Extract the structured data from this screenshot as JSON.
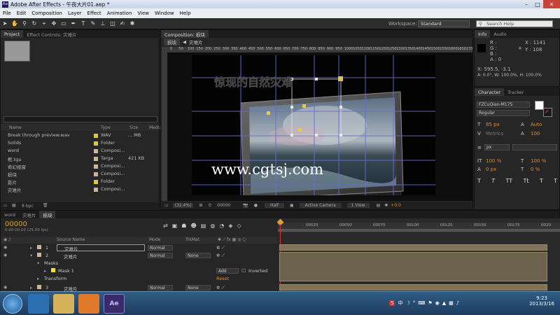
{
  "window": {
    "title": "Adobe After Effects - 午夜大片01.aep *",
    "app_badge": "Ae"
  },
  "menu": [
    "File",
    "Edit",
    "Composition",
    "Layer",
    "Effect",
    "Animation",
    "View",
    "Window",
    "Help"
  ],
  "toolbar": {
    "workspace_label": "Workspace:",
    "workspace_value": "Standard",
    "search_placeholder": "Search Help"
  },
  "project": {
    "tabs": [
      "Project",
      "Effect Controls: 灾难片"
    ],
    "columns": [
      "Name",
      "Type",
      "Size",
      "Media"
    ],
    "items": [
      {
        "name": "Break through preview.wav",
        "type": "WAV",
        "size": "... MB",
        "color": "#d8c64a"
      },
      {
        "name": "Solids",
        "type": "Folder",
        "size": "",
        "color": "#d8c64a"
      },
      {
        "name": "word",
        "type": "Composi...",
        "size": "",
        "color": "#c8b79a"
      },
      {
        "name": "框.tga",
        "type": "Targa",
        "size": "421 KB",
        "color": "#c8b79a"
      },
      {
        "name": "奇幻视窗",
        "type": "Composi...",
        "size": "",
        "color": "#c8b79a"
      },
      {
        "name": "损块",
        "type": "Composi...",
        "size": "",
        "color": "#c8b79a"
      },
      {
        "name": "影片",
        "type": "Folder",
        "size": "",
        "color": "#d8c64a"
      },
      {
        "name": "灾难片",
        "type": "Composi...",
        "size": "",
        "color": "#c8b79a"
      }
    ],
    "bpc": "8 bpc"
  },
  "composition": {
    "tab": "Composition: 损块",
    "breadcrumbs": [
      "损块",
      "灾难片"
    ],
    "ruler_ticks": [
      "0",
      "50",
      "100",
      "150",
      "200",
      "250",
      "300",
      "350",
      "400",
      "450",
      "500",
      "550",
      "600",
      "650",
      "700",
      "750",
      "800",
      "850",
      "900",
      "950",
      "1000",
      "1050",
      "1100",
      "1150",
      "1200",
      "1250",
      "1300",
      "1350",
      "1400",
      "1450",
      "1500",
      "1550",
      "1600",
      "1650",
      "1700"
    ],
    "title_text": "惊现的自然灾难",
    "watermark": "www.cgtsj.com",
    "footer": {
      "zoom": "(32.4%)",
      "timecode": "00000",
      "resolution": "Half",
      "camera": "Active Camera",
      "views": "1 View",
      "exposure": "+0.0"
    }
  },
  "info": {
    "tabs": [
      "Info",
      "Audio"
    ],
    "r": "R :",
    "g": "G :",
    "b": "B :",
    "a": "A : 0",
    "x": "X : 1141",
    "y": "Y : 108",
    "line1": "X: 595.5, -3.1",
    "line2": "A: 0.0°, W: 100.0%, H: 100.0%"
  },
  "character": {
    "tabs": [
      "Character",
      "Tracker"
    ],
    "font": "FZCuQian-M17S",
    "style": "Regular",
    "size": "85 px",
    "leading": "Auto",
    "kerning": "Metrics",
    "tracking": "100",
    "stroke_unit": "px",
    "vscale": "100 %",
    "hscale": "100 %",
    "baseline": "0 px",
    "tsume": "0 %",
    "styles": [
      "T",
      "T",
      "TT",
      "Tt",
      "T",
      "T"
    ]
  },
  "timeline": {
    "tabs": [
      "word",
      "灾难片",
      "损块"
    ],
    "timecode": "00000",
    "timecode_sub": "0:00:00:00 (25.00 fps)",
    "headers": {
      "source": "Source Name",
      "mode": "Mode",
      "trkmat": "TrkMat"
    },
    "ticks": [
      "00025",
      "00050",
      "00075",
      "00100",
      "00125",
      "00150",
      "00175",
      "0020"
    ],
    "layers": [
      {
        "num": "1",
        "name": "灾难片",
        "mode": "Normal",
        "trkmat": ""
      },
      {
        "num": "2",
        "name": "灾难片",
        "mode": "Normal",
        "trkmat": "None"
      },
      {
        "num": "3",
        "name": "灾难片",
        "mode": "Normal",
        "trkmat": "None"
      }
    ],
    "masks_label": "Masks",
    "mask1": "Mask 1",
    "mask_mode": "Add",
    "inverted": "Inverted",
    "transform": "Transform",
    "reset": "Reset"
  },
  "taskbar": {
    "time": "9:23",
    "date": "2013/3/16",
    "ime": "中"
  }
}
